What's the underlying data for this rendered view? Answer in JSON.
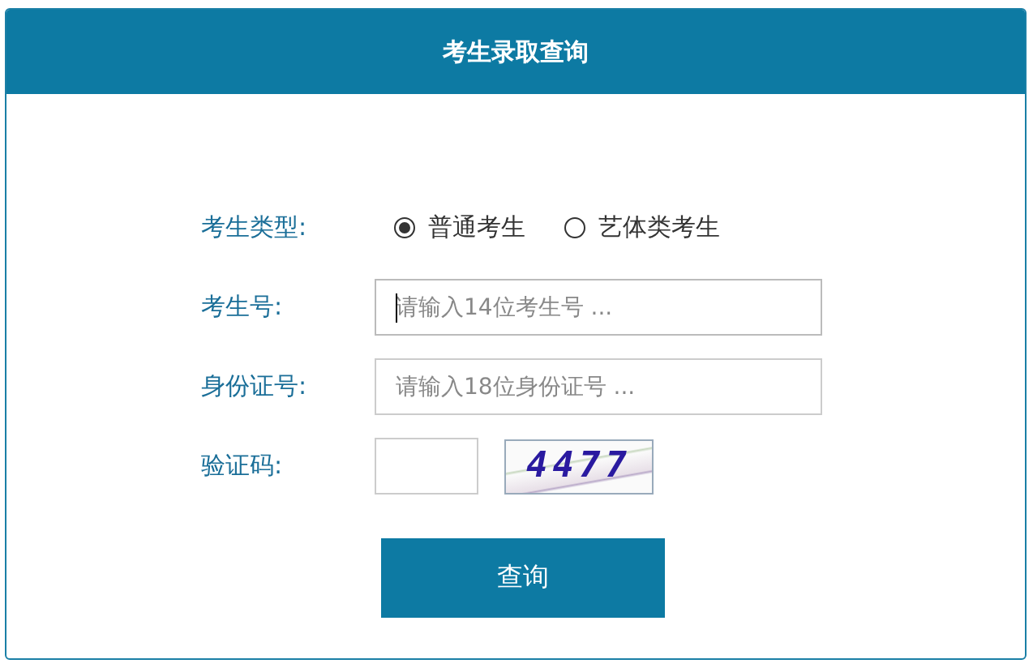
{
  "header": {
    "title": "考生录取查询"
  },
  "form": {
    "type_label": "考生类型:",
    "types": [
      {
        "label": "普通考生",
        "selected": true
      },
      {
        "label": "艺体类考生",
        "selected": false
      }
    ],
    "fields": [
      {
        "label": "考生号:",
        "placeholder": "请输入14位考生号 ...",
        "focused": true
      },
      {
        "label": "身份证号:",
        "placeholder": "请输入18位身份证号 ...",
        "focused": false
      }
    ],
    "captcha": {
      "label": "验证码:",
      "code": "4477"
    },
    "submit": "查询"
  }
}
